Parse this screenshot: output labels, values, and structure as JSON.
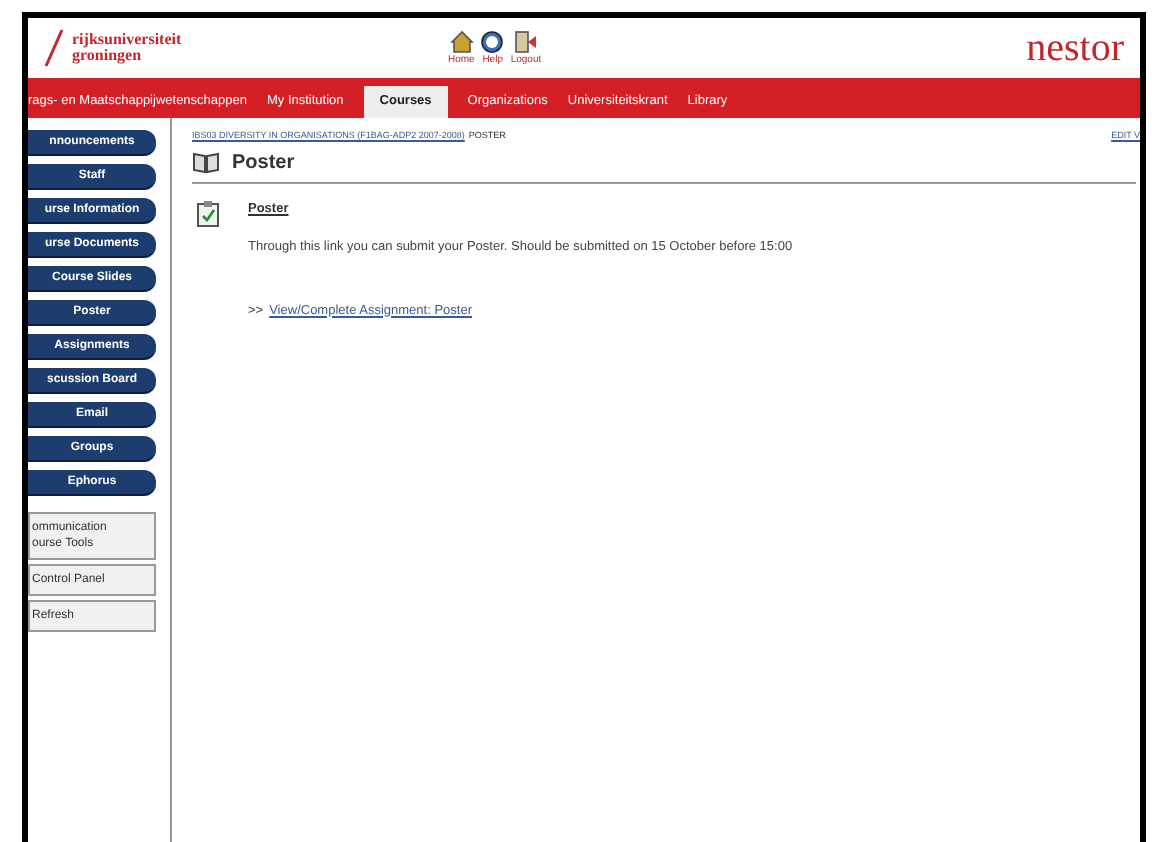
{
  "header": {
    "logo_text": [
      "rijksuniversiteit",
      "groningen"
    ],
    "tools": [
      {
        "kind": "home",
        "label": "Home"
      },
      {
        "kind": "help",
        "label": "Help"
      },
      {
        "kind": "logout",
        "label": "Logout"
      }
    ],
    "brand": "nestor"
  },
  "tabs": [
    {
      "label": "rags- en Maatschappijwetenschappen",
      "selected": false
    },
    {
      "label": "My Institution",
      "selected": false
    },
    {
      "label": "Courses",
      "selected": true
    },
    {
      "label": "Organizations",
      "selected": false
    },
    {
      "label": "Universiteitskrant",
      "selected": false
    },
    {
      "label": "Library",
      "selected": false
    }
  ],
  "sidebar": {
    "buttons": [
      "nnouncements",
      "Staff",
      "urse Information",
      "urse Documents",
      "Course Slides",
      "Poster",
      "Assignments",
      "scussion Board",
      "Email",
      "Groups",
      "Ephorus"
    ],
    "boxes": [
      [
        "ommunication",
        "ourse Tools"
      ],
      [
        "Control Panel"
      ],
      [
        "Refresh"
      ]
    ]
  },
  "breadcrumb": {
    "path": "IBS03 DIVERSITY IN ORGANISATIONS (F1BAG-ADP2 2007-2008)",
    "current": "POSTER",
    "edit": "EDIT V"
  },
  "page_title": "Poster",
  "item": {
    "title": "Poster",
    "description": "Through this link you can submit your Poster. Should be submitted on 15 October before 15:00",
    "link_prefix": ">>",
    "link": "View/Complete Assignment: Poster"
  }
}
